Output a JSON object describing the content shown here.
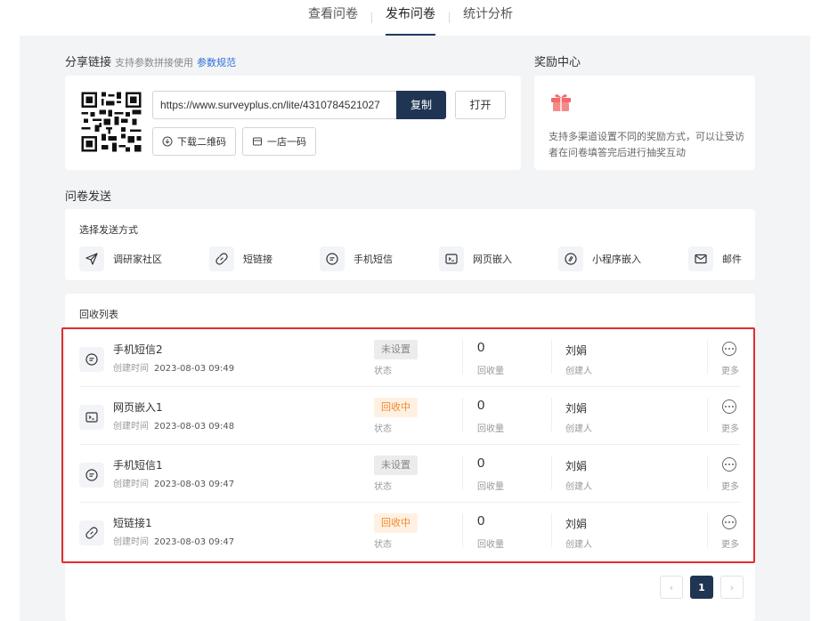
{
  "nav": {
    "tabs": [
      {
        "label": "查看问卷"
      },
      {
        "label": "发布问卷"
      },
      {
        "label": "统计分析"
      }
    ],
    "active_index": 1
  },
  "share": {
    "title": "分享链接",
    "hint": "支持参数拼接使用",
    "spec_link": "参数规范",
    "url": "https://www.surveyplus.cn/lite/4310784521027",
    "copy_label": "复制",
    "open_label": "打开",
    "download_qr_label": "下载二维码",
    "one_shop_label": "一店一码"
  },
  "reward": {
    "title": "奖励中心",
    "description": "支持多渠道设置不同的奖励方式，可以让受访者在问卷填答完后进行抽奖互动"
  },
  "send": {
    "section_title": "问卷发送",
    "methods_title": "选择发送方式",
    "methods": [
      {
        "label": "调研家社区",
        "icon": "paper-plane-icon"
      },
      {
        "label": "短链接",
        "icon": "link-icon"
      },
      {
        "label": "手机短信",
        "icon": "message-icon"
      },
      {
        "label": "网页嵌入",
        "icon": "terminal-icon"
      },
      {
        "label": "小程序嵌入",
        "icon": "mini-program-icon"
      },
      {
        "label": "邮件",
        "icon": "mail-icon"
      }
    ]
  },
  "recovery": {
    "title": "回收列表",
    "created_label": "创建时间",
    "status_label": "状态",
    "count_label": "回收量",
    "creator_label": "创建人",
    "more_label": "更多",
    "rows": [
      {
        "name": "手机短信2",
        "created": "2023-08-03 09:49",
        "status": "未设置",
        "status_type": "unset",
        "count": "0",
        "creator": "刘娟",
        "icon": "message-icon"
      },
      {
        "name": "网页嵌入1",
        "created": "2023-08-03 09:48",
        "status": "回收中",
        "status_type": "collecting",
        "count": "0",
        "creator": "刘娟",
        "icon": "terminal-icon"
      },
      {
        "name": "手机短信1",
        "created": "2023-08-03 09:47",
        "status": "未设置",
        "status_type": "unset",
        "count": "0",
        "creator": "刘娟",
        "icon": "message-icon"
      },
      {
        "name": "短链接1",
        "created": "2023-08-03 09:47",
        "status": "回收中",
        "status_type": "collecting",
        "count": "0",
        "creator": "刘娟",
        "icon": "link-icon"
      }
    ]
  },
  "pagination": {
    "prev": "‹",
    "current": "1",
    "next": "›"
  },
  "colors": {
    "primary": "#1f3553",
    "accent_link": "#2e6fd8",
    "highlight": "#e02d2d",
    "collecting": "#f08a2e",
    "gift": "#f26a6a"
  }
}
